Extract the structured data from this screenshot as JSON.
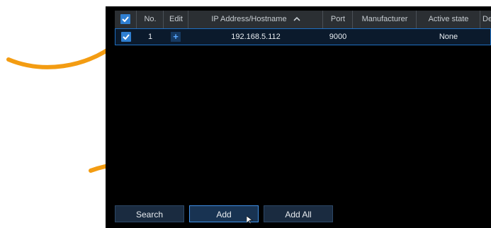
{
  "table": {
    "columns": [
      "No.",
      "Edit",
      "IP Address/Hostname",
      "Port",
      "Manufacturer",
      "Active state",
      "De"
    ],
    "sort_icon": "chevron-up-icon",
    "rows": [
      {
        "no": "1",
        "edit_icon": "plus-icon",
        "ip": "192.168.5.112",
        "port": "9000",
        "manufacturer": "",
        "state": "None",
        "checked": true
      }
    ]
  },
  "buttons": {
    "search": "Search",
    "add": "Add",
    "add_all": "Add All"
  },
  "colors": {
    "accent": "#2f7fd1",
    "arrow": "#f39c12",
    "panel": "#000000"
  }
}
